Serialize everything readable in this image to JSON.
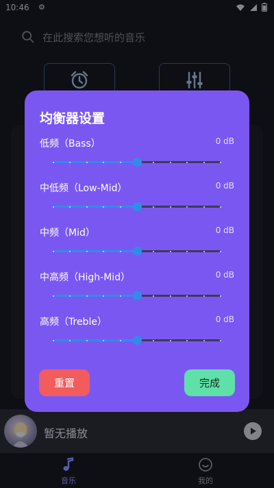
{
  "status_bar": {
    "time": "10:46",
    "gear": "⚙"
  },
  "search": {
    "placeholder": "在此搜索您想听的音乐"
  },
  "equalizer": {
    "title": "均衡器设置",
    "bands": [
      {
        "label": "低频（Bass）",
        "value": "0 dB",
        "level": 0.5
      },
      {
        "label": "中低频（Low-Mid）",
        "value": "0 dB",
        "level": 0.5
      },
      {
        "label": "中频（Mid）",
        "value": "0 dB",
        "level": 0.5
      },
      {
        "label": "中高频（High-Mid）",
        "value": "0 dB",
        "level": 0.5
      },
      {
        "label": "高频（Treble）",
        "value": "0 dB",
        "level": 0.5
      }
    ],
    "reset_label": "重置",
    "done_label": "完成"
  },
  "player": {
    "now_playing": "暂无播放"
  },
  "nav": {
    "music_label": "音乐",
    "mine_label": "我的"
  },
  "colors": {
    "dialog_bg": "#7b57f2",
    "slider_active": "#2f8ce8",
    "reset_btn": "#f25c5c",
    "done_btn": "#5fe0a9",
    "nav_active": "#8a8cff"
  }
}
